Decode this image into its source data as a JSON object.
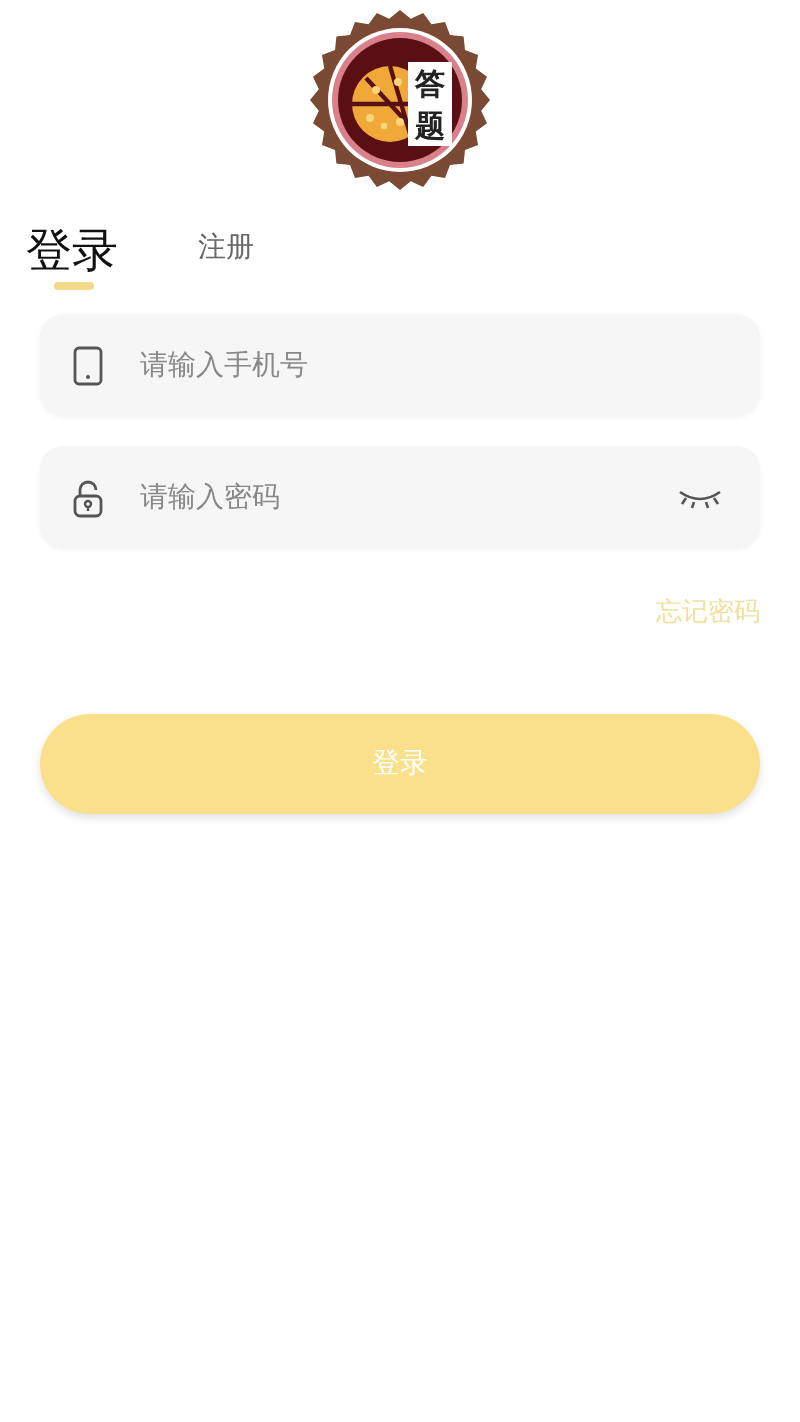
{
  "logo": {
    "badge_text": [
      "答",
      "题"
    ]
  },
  "tabs": [
    {
      "label": "登录",
      "selected": true
    },
    {
      "label": "注册",
      "selected": false
    }
  ],
  "fields": [
    {
      "kind": "phone",
      "placeholder": "请输入手机号"
    },
    {
      "kind": "password",
      "placeholder": "请输入密码"
    }
  ],
  "forgot_password": "忘记密码",
  "submit_button": "登录"
}
